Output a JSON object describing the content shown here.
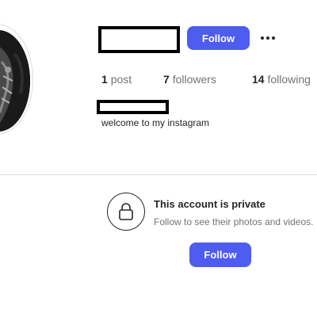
{
  "header": {
    "follow_label": "Follow",
    "more_icon": "more-horizontal-icon"
  },
  "stats": {
    "posts": {
      "count": "1",
      "label": "post"
    },
    "followers": {
      "count": "7",
      "label": "followers"
    },
    "following": {
      "count": "14",
      "label": "following"
    }
  },
  "bio": {
    "text": "welcome to my instagram"
  },
  "private_notice": {
    "icon": "lock-icon",
    "title": "This account is private",
    "subtitle": "Follow to see their photos and videos.",
    "follow_label": "Follow"
  },
  "colors": {
    "accent": "#4f5cf0",
    "text": "#262626",
    "muted": "#737373",
    "divider": "#dbdbdb"
  }
}
